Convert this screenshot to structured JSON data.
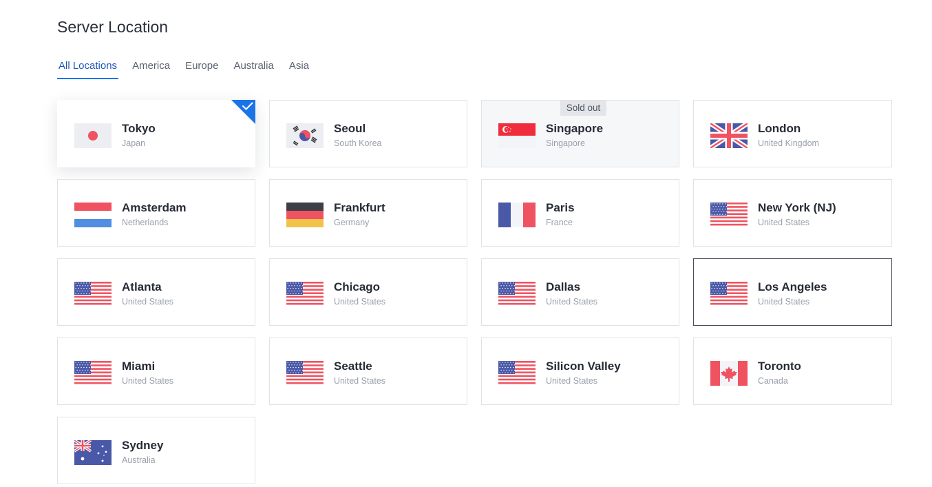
{
  "page": {
    "title": "Server Location"
  },
  "tabs": [
    {
      "label": "All Locations",
      "active": true
    },
    {
      "label": "America",
      "active": false
    },
    {
      "label": "Europe",
      "active": false
    },
    {
      "label": "Australia",
      "active": false
    },
    {
      "label": "Asia",
      "active": false
    }
  ],
  "locations": [
    {
      "city": "Tokyo",
      "country": "Japan",
      "flag": "japan-flag-icon",
      "state": "selected"
    },
    {
      "city": "Seoul",
      "country": "South Korea",
      "flag": "south-korea-flag-icon",
      "state": "normal"
    },
    {
      "city": "Singapore",
      "country": "Singapore",
      "flag": "singapore-flag-icon",
      "state": "soldout",
      "badge": "Sold out"
    },
    {
      "city": "London",
      "country": "United Kingdom",
      "flag": "uk-flag-icon",
      "state": "normal"
    },
    {
      "city": "Amsterdam",
      "country": "Netherlands",
      "flag": "netherlands-flag-icon",
      "state": "normal"
    },
    {
      "city": "Frankfurt",
      "country": "Germany",
      "flag": "germany-flag-icon",
      "state": "normal"
    },
    {
      "city": "Paris",
      "country": "France",
      "flag": "france-flag-icon",
      "state": "normal"
    },
    {
      "city": "New York (NJ)",
      "country": "United States",
      "flag": "us-flag-icon",
      "state": "normal"
    },
    {
      "city": "Atlanta",
      "country": "United States",
      "flag": "us-flag-icon",
      "state": "normal"
    },
    {
      "city": "Chicago",
      "country": "United States",
      "flag": "us-flag-icon",
      "state": "normal"
    },
    {
      "city": "Dallas",
      "country": "United States",
      "flag": "us-flag-icon",
      "state": "normal"
    },
    {
      "city": "Los Angeles",
      "country": "United States",
      "flag": "us-flag-icon",
      "state": "hovered"
    },
    {
      "city": "Miami",
      "country": "United States",
      "flag": "us-flag-icon",
      "state": "normal"
    },
    {
      "city": "Seattle",
      "country": "United States",
      "flag": "us-flag-icon",
      "state": "normal"
    },
    {
      "city": "Silicon Valley",
      "country": "United States",
      "flag": "us-flag-icon",
      "state": "normal"
    },
    {
      "city": "Toronto",
      "country": "Canada",
      "flag": "canada-flag-icon",
      "state": "normal"
    },
    {
      "city": "Sydney",
      "country": "Australia",
      "flag": "australia-flag-icon",
      "state": "normal"
    }
  ],
  "colors": {
    "accent": "#1b73e8",
    "active_tab_text": "#1b57b8",
    "flag_red": "#ef5361",
    "flag_blue": "#4a58a8"
  }
}
